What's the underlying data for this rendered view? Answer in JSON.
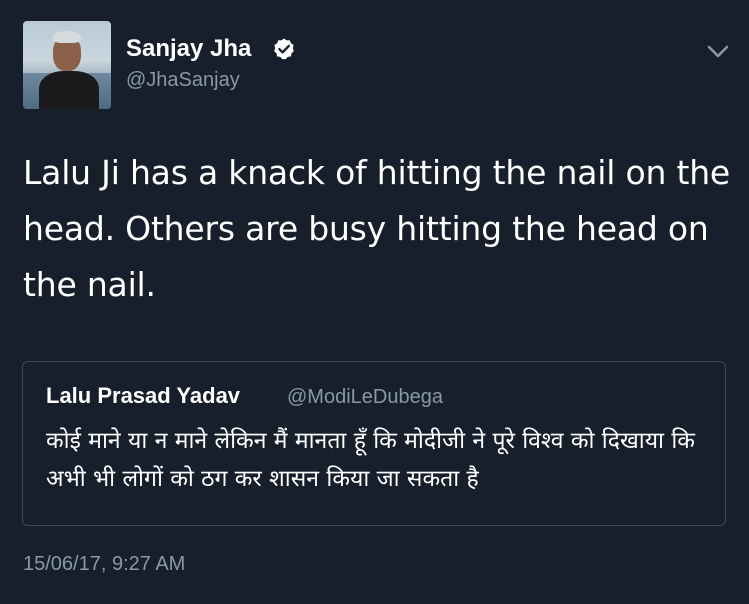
{
  "tweet": {
    "author": {
      "display_name": "Sanjay Jha",
      "handle": "@JhaSanjay",
      "verified": true,
      "avatar": "profile-photo"
    },
    "text": "Lalu Ji has a knack of hitting the nail on the head. Others are busy hitting the head on the nail.",
    "quoted_tweet": {
      "display_name": "Lalu Prasad Yadav",
      "handle": "@ModiLeDubega",
      "text": "कोई माने या न माने लेकिन मैं मानता हूँ कि मोदीजी ने पूरे विश्व को दिखाया कि अभी भी लोगों को ठग कर शासन किया जा सकता है"
    },
    "timestamp": "15/06/17, 9:27 AM"
  },
  "icons": {
    "verified": "verified-badge-icon",
    "menu": "chevron-down-icon"
  },
  "colors": {
    "background": "#161f2b",
    "primary_text": "#ffffff",
    "secondary_text": "#8899a6",
    "card_border": "#3a4b5c"
  }
}
